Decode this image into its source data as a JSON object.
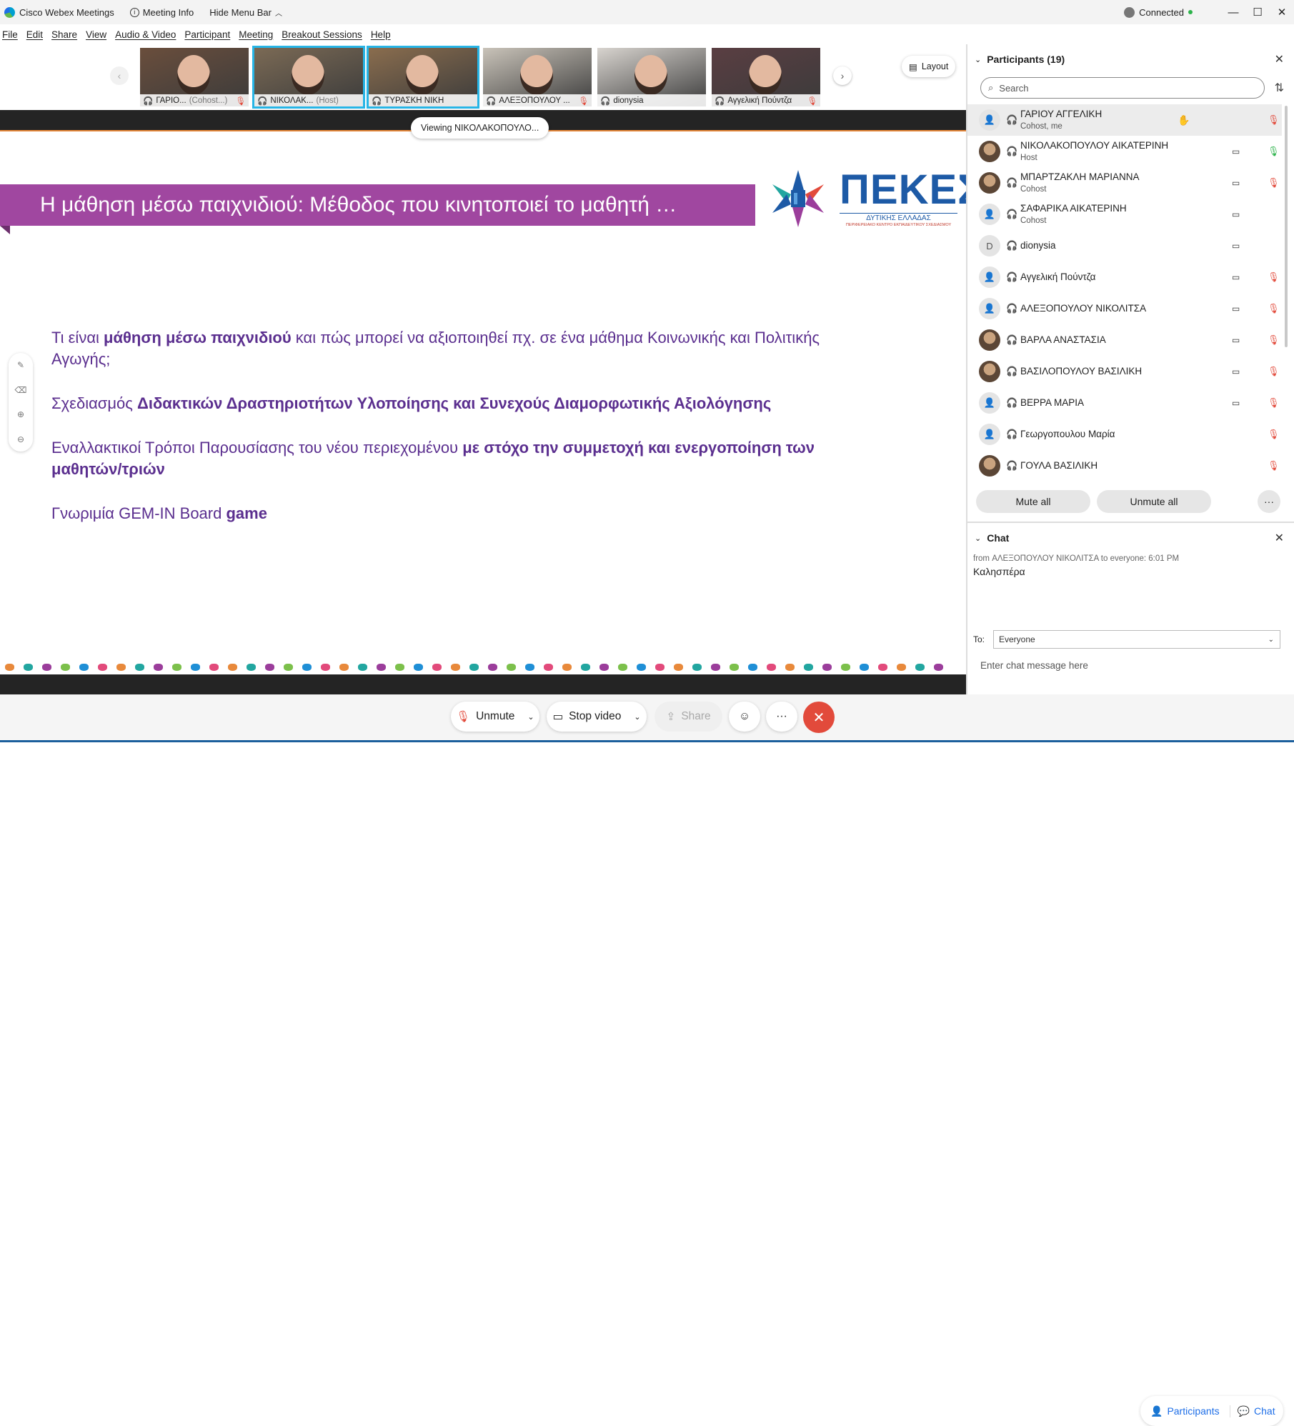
{
  "titlebar": {
    "app_name": "Cisco Webex Meetings",
    "meeting_info": "Meeting Info",
    "hide_menu": "Hide Menu Bar",
    "hide_menu_caret": "︿",
    "connection_status": "Connected",
    "minimize": "—",
    "maximize": "☐",
    "close": "✕"
  },
  "menu": [
    "File",
    "Edit",
    "Share",
    "View",
    "Audio & Video",
    "Participant",
    "Meeting",
    "Breakout Sessions",
    "Help"
  ],
  "video_strip": {
    "prev_arrow": "‹",
    "next_arrow": "›",
    "layout_label": "Layout",
    "tiles": [
      {
        "name": "ΓΑΡΙΟ...",
        "role": "(Cohost...)",
        "muted": true,
        "active": false,
        "bg": "#6a4e3c"
      },
      {
        "name": "ΝΙΚΟΛΑΚ...",
        "role": "(Host)",
        "muted": false,
        "active": true,
        "bg": "#7b6a55"
      },
      {
        "name": "ΤΥΡΑΣΚΗ ΝΙΚΗ",
        "role": "",
        "muted": false,
        "active": true,
        "bg": "#8a6d4e"
      },
      {
        "name": "ΑΛΕΞΟΠΟΥΛΟΥ ...",
        "role": "",
        "muted": true,
        "active": false,
        "bg": "#c9c3b9"
      },
      {
        "name": "dionysia",
        "role": "",
        "muted": false,
        "active": false,
        "bg": "#d8d4cf"
      },
      {
        "name": "Αγγελική Πούντζα",
        "role": "",
        "muted": true,
        "active": false,
        "bg": "#5a3e42"
      }
    ]
  },
  "stage": {
    "viewing_label": "Viewing ΝΙΚΟΛΑΚΟΠΟΥΛΟ...",
    "slide_title": "Η μάθηση μέσω παιχνιδιού: Μέθοδος που κινητοποιεί το μαθητή …",
    "logo_main": "ΠΕΚΕΣ",
    "logo_sub": "ΔΥΤΙΚΗΣ ΕΛΛΑΔΑΣ",
    "logo_sub2": "ΠΕΡΙΦΕΡΕΙΑΚΟ ΚΕΝΤΡΟ ΕΚΠΑΙΔΕΥΤΙΚΟΥ ΣΧΕΔΙΑΣΜΟΥ",
    "p1_a": "Τι είναι ",
    "p1_b": "μάθηση μέσω παιχνιδιού",
    "p1_c": " και πώς μπορεί να αξιοποιηθεί πχ. σε ένα μάθημα Κοινωνικής και Πολιτικής Αγωγής;",
    "p2_a": "Σχεδιασμός ",
    "p2_b": "Διδακτικών Δραστηριοτήτων Υλοποίησης και Συνεχούς Διαμορφωτικής Αξιολόγησης",
    "p3_a": "Εναλλακτικοί Τρόποι Παρουσίασης του νέου περιεχομένου ",
    "p3_b": "με στόχο την συμμετοχή και ενεργοποίηση των μαθητών/τριών",
    "p4_a": "Γνωριμία GEM-IN Board ",
    "p4_b": "game",
    "dot_colors": [
      "#e8893b",
      "#22a6a0",
      "#9b3d9b",
      "#7cc04b",
      "#1f8fd6",
      "#e24a7b"
    ]
  },
  "controls": {
    "unmute": "Unmute",
    "stop_video": "Stop video",
    "share": "Share",
    "reactions_icon": "☺",
    "more_icon": "···",
    "end_icon": "✕",
    "participants_tab": "Participants",
    "chat_tab": "Chat"
  },
  "participants": {
    "header": "Participants (19)",
    "search_placeholder": "Search",
    "mute_all": "Mute all",
    "unmute_all": "Unmute all",
    "list": [
      {
        "name": "ΓΑΡΙΟΥ ΑΓΓΕΛΙΚΗ",
        "role": "Cohost, me",
        "avatar": "person",
        "video": false,
        "mic": "off",
        "hand": true,
        "self": true
      },
      {
        "name": "ΝΙΚΟΛΑΚΟΠΟΥΛΟΥ ΑΙΚΑΤΕΡΙΝΗ",
        "role": "Host",
        "avatar": "photo",
        "video": true,
        "mic": "on",
        "hand": false,
        "self": false
      },
      {
        "name": "ΜΠΑΡΤΖΑΚΛΗ ΜΑΡΙΑΝΝΑ",
        "role": "Cohost",
        "avatar": "photo",
        "video": true,
        "mic": "off",
        "hand": false,
        "self": false
      },
      {
        "name": "ΣΑΦΑΡΙΚΑ ΑΙΚΑΤΕΡΙΝΗ",
        "role": "Cohost",
        "avatar": "person",
        "video": true,
        "mic": "none",
        "hand": false,
        "self": false
      },
      {
        "name": "dionysia",
        "role": "",
        "avatar": "D",
        "video": true,
        "mic": "none",
        "hand": false,
        "self": false
      },
      {
        "name": "Αγγελική Πούντζα",
        "role": "",
        "avatar": "person",
        "video": true,
        "mic": "off",
        "hand": false,
        "self": false
      },
      {
        "name": "ΑΛΕΞΟΠΟΥΛΟΥ ΝΙΚΟΛΙΤΣΑ",
        "role": "",
        "avatar": "person",
        "video": true,
        "mic": "off",
        "hand": false,
        "self": false
      },
      {
        "name": "ΒΑΡΛΑ ΑΝΑΣΤΑΣΙΑ",
        "role": "",
        "avatar": "photo",
        "video": true,
        "mic": "off",
        "hand": false,
        "self": false
      },
      {
        "name": "ΒΑΣΙΛΟΠΟΥΛΟΥ ΒΑΣΙΛΙΚΗ",
        "role": "",
        "avatar": "photo",
        "video": true,
        "mic": "off",
        "hand": false,
        "self": false
      },
      {
        "name": "ΒΕΡΡΑ ΜΑΡΙΑ",
        "role": "",
        "avatar": "person",
        "video": true,
        "mic": "off",
        "hand": false,
        "self": false
      },
      {
        "name": "Γεωργοπουλου Μαρία",
        "role": "",
        "avatar": "person",
        "video": false,
        "mic": "off",
        "hand": false,
        "self": false
      },
      {
        "name": "ΓΟΥΛΑ ΒΑΣΙΛΙΚΗ",
        "role": "",
        "avatar": "photo",
        "video": false,
        "mic": "off",
        "hand": false,
        "self": false
      }
    ]
  },
  "chat": {
    "header": "Chat",
    "meta": "from ΑΛΕΞΟΠΟΥΛΟΥ ΝΙΚΟΛΙΤΣΑ to everyone:    6:01 PM",
    "message": "Καλησπέρα",
    "to_label": "To:",
    "to_value": "Everyone",
    "input_placeholder": "Enter chat message here"
  }
}
